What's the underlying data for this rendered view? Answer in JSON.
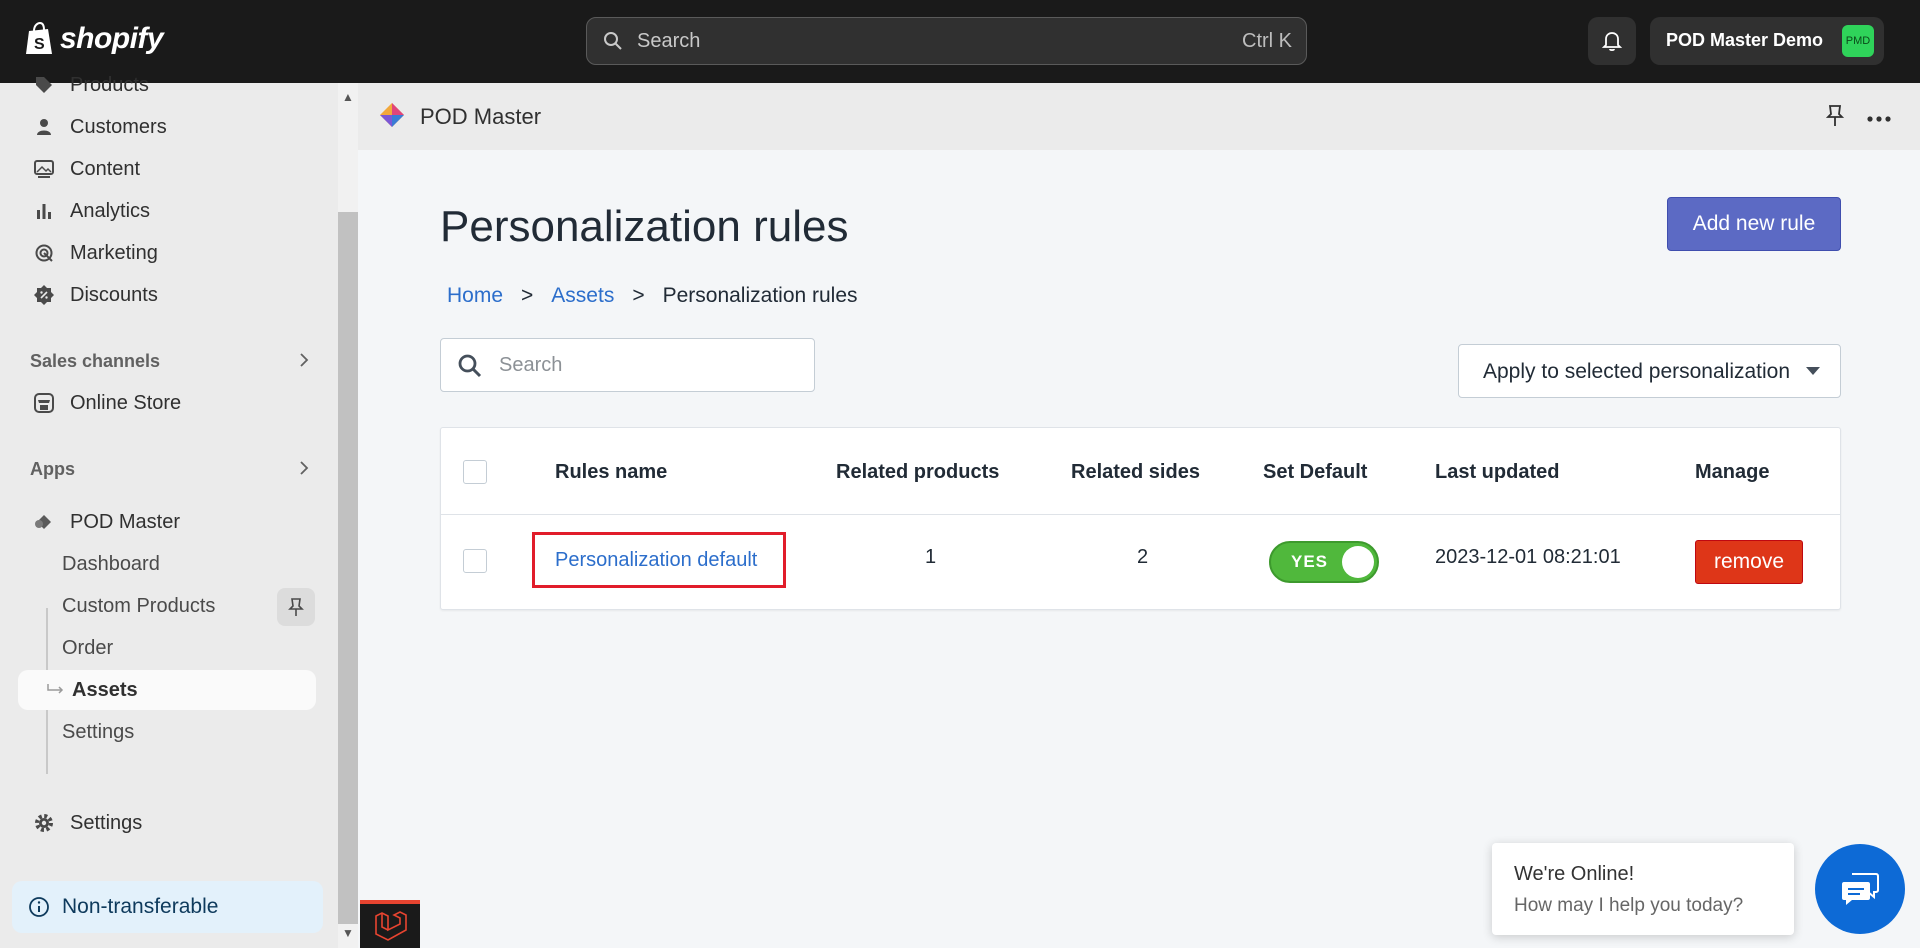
{
  "topbar": {
    "logo_text": "shopify",
    "search_placeholder": "Search",
    "search_shortcut": "Ctrl K",
    "store_name": "POD Master Demo",
    "store_avatar": "PMD",
    "icons": {
      "bell": "bell-icon",
      "search": "search-icon"
    }
  },
  "sidebar": {
    "items": [
      {
        "label": "Products",
        "icon": "tag-icon"
      },
      {
        "label": "Customers",
        "icon": "person-icon"
      },
      {
        "label": "Content",
        "icon": "image-icon"
      },
      {
        "label": "Analytics",
        "icon": "bar-chart-icon"
      },
      {
        "label": "Marketing",
        "icon": "target-icon"
      },
      {
        "label": "Discounts",
        "icon": "discount-icon"
      }
    ],
    "sales_channels_label": "Sales channels",
    "online_store_label": "Online Store",
    "apps_label": "Apps",
    "app_name": "POD Master",
    "app_sub": [
      {
        "label": "Dashboard"
      },
      {
        "label": "Custom Products"
      },
      {
        "label": "Order"
      },
      {
        "label": "Assets"
      },
      {
        "label": "Settings"
      }
    ],
    "settings_label": "Settings",
    "badge_label": "Non-transferable"
  },
  "app_header": {
    "title": "POD Master"
  },
  "main": {
    "title": "Personalization rules",
    "add_button": "Add new rule",
    "breadcrumb": {
      "home": "Home",
      "sep1": ">",
      "assets": "Assets",
      "sep2": ">",
      "current": "Personalization rules"
    },
    "search_placeholder": "Search",
    "apply_select": "Apply to selected personalization",
    "table": {
      "headers": {
        "rules_name": "Rules name",
        "related_products": "Related products",
        "related_sides": "Related sides",
        "set_default": "Set Default",
        "last_updated": "Last updated",
        "manage": "Manage"
      },
      "rows": [
        {
          "rules_name": "Personalization default",
          "related_products": "1",
          "related_sides": "2",
          "set_default": "YES",
          "last_updated": "2023-12-01 08:21:01",
          "manage": "remove"
        }
      ]
    }
  },
  "chat": {
    "title": "We're Online!",
    "subtitle": "How may I help you today?"
  },
  "colors": {
    "primary_button": "#5c6ac4",
    "link": "#2c6ecb",
    "remove": "#de3618",
    "toggle_on": "#50b83c",
    "highlight_box": "#e11d2a",
    "chat": "#0d6ad6"
  }
}
